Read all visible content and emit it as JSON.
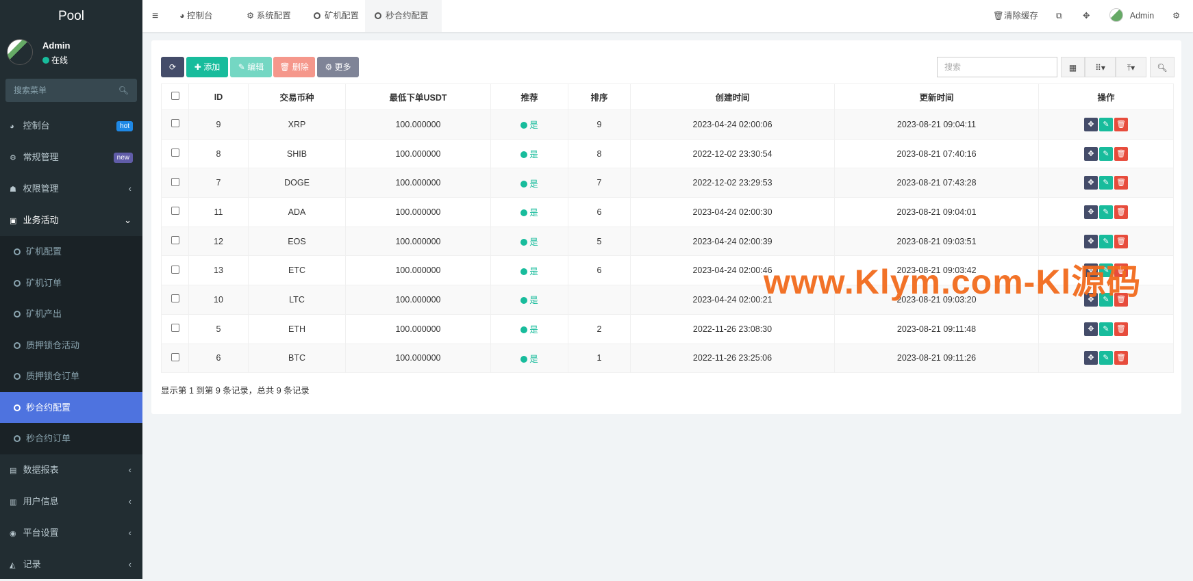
{
  "sidebar": {
    "logo": "Pool",
    "user": "Admin",
    "status": "在线",
    "search_placeholder": "搜索菜单",
    "items": [
      {
        "label": "控制台",
        "badge": "hot",
        "badge_color": "#1e88e5"
      },
      {
        "label": "常规管理",
        "badge": "new",
        "badge_color": "#605ca8"
      },
      {
        "label": "权限管理"
      },
      {
        "label": "业务活动"
      }
    ],
    "sub": [
      "矿机配置",
      "矿机订单",
      "矿机产出",
      "质押锁仓活动",
      "质押锁仓订单",
      "秒合约配置",
      "秒合约订单"
    ],
    "items2": [
      "数据报表",
      "用户信息",
      "平台设置",
      "记录"
    ]
  },
  "header": {
    "tabs": [
      "控制台",
      "系统配置",
      "矿机配置",
      "秒合约配置"
    ],
    "clear_cache": "清除缓存",
    "user": "Admin"
  },
  "toolbar": {
    "add": "添加",
    "edit": "编辑",
    "delete": "删除",
    "more": "更多",
    "search_placeholder": "搜索"
  },
  "table": {
    "headers": [
      "ID",
      "交易币种",
      "最低下单USDT",
      "推荐",
      "排序",
      "创建时间",
      "更新时间",
      "操作"
    ],
    "rows": [
      [
        "9",
        "XRP",
        "100.000000",
        "是",
        "9",
        "2023-04-24 02:00:06",
        "2023-08-21 09:04:11"
      ],
      [
        "8",
        "SHIB",
        "100.000000",
        "是",
        "8",
        "2022-12-02 23:30:54",
        "2023-08-21 07:40:16"
      ],
      [
        "7",
        "DOGE",
        "100.000000",
        "是",
        "7",
        "2022-12-02 23:29:53",
        "2023-08-21 07:43:28"
      ],
      [
        "11",
        "ADA",
        "100.000000",
        "是",
        "6",
        "2023-04-24 02:00:30",
        "2023-08-21 09:04:01"
      ],
      [
        "12",
        "EOS",
        "100.000000",
        "是",
        "5",
        "2023-04-24 02:00:39",
        "2023-08-21 09:03:51"
      ],
      [
        "13",
        "ETC",
        "100.000000",
        "是",
        "6",
        "2023-04-24 02:00:46",
        "2023-08-21 09:03:42"
      ],
      [
        "10",
        "LTC",
        "100.000000",
        "是",
        "",
        "2023-04-24 02:00:21",
        "2023-08-21 09:03:20"
      ],
      [
        "5",
        "ETH",
        "100.000000",
        "是",
        "2",
        "2022-11-26 23:08:30",
        "2023-08-21 09:11:48"
      ],
      [
        "6",
        "BTC",
        "100.000000",
        "是",
        "1",
        "2022-11-26 23:25:06",
        "2023-08-21 09:11:26"
      ]
    ]
  },
  "footer": "显示第 1 到第 9 条记录，总共 9 条记录",
  "watermark": "www.Klym.com-Kl源码"
}
